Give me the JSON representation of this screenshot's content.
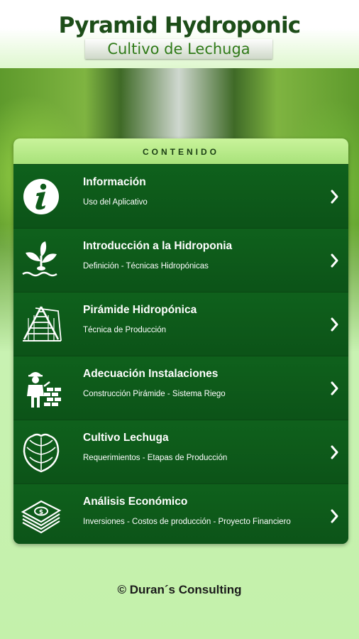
{
  "header": {
    "title": "Pyramid Hydroponic",
    "subtitle": "Cultivo de Lechuga"
  },
  "panel": {
    "heading": "CONTENIDO",
    "items": [
      {
        "title": "Información",
        "subtitle": "Uso del Aplicativo",
        "icon": "info-icon"
      },
      {
        "title": "Introducción a la Hidroponia",
        "subtitle": "Definición - Técnicas Hidropónicas",
        "icon": "plant-water-icon"
      },
      {
        "title": "Pirámide Hidropónica",
        "subtitle": "Técnica de Producción",
        "icon": "pyramid-structure-icon"
      },
      {
        "title": "Adecuación Instalaciones",
        "subtitle": "Construcción Pirámide - Sistema Riego",
        "icon": "builder-icon"
      },
      {
        "title": "Cultivo Lechuga",
        "subtitle": "Requerimientos - Etapas de Producción",
        "icon": "lettuce-icon"
      },
      {
        "title": "Análisis Económico",
        "subtitle": "Inversiones - Costos de producción - Proyecto Financiero",
        "icon": "money-stack-icon"
      }
    ]
  },
  "footer": {
    "copyright": "© Duran´s Consulting"
  }
}
